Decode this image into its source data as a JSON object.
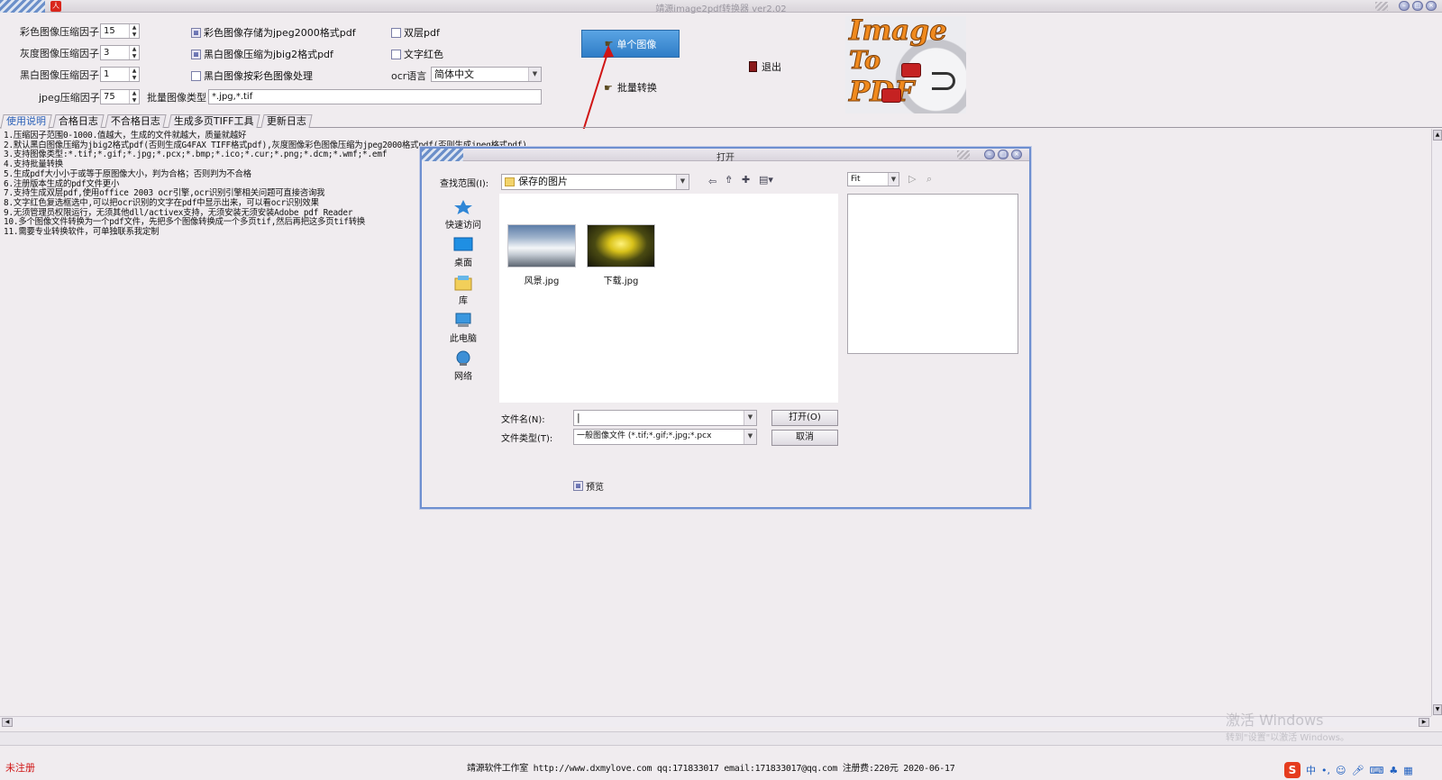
{
  "window": {
    "title": "靖源image2pdf转换器 ver2.02",
    "controls": [
      "minimize",
      "maximize",
      "close"
    ]
  },
  "settings": {
    "color_factor_label": "彩色图像压缩因子",
    "color_factor_value": "15",
    "gray_factor_label": "灰度图像压缩因子",
    "gray_factor_value": "3",
    "bw_factor_label": "黑白图像压缩因子",
    "bw_factor_value": "1",
    "jpeg_factor_label": "jpeg压缩因子",
    "jpeg_factor_value": "75",
    "opt_jpeg2000": "彩色图像存储为jpeg2000格式pdf",
    "opt_jbig2": "黑白图像压缩为jbig2格式pdf",
    "opt_bw_as_color": "黑白图像按彩色图像处理",
    "opt_dual_layer": "双层pdf",
    "opt_red_text": "文字红色",
    "ocr_label": "ocr语言",
    "ocr_value": "简体中文",
    "batch_type_label": "批量图像类型",
    "batch_type_value": "*.jpg,*.tif"
  },
  "actions": {
    "single": "单个图像",
    "batch": "批量转换",
    "exit": "退出"
  },
  "logo": {
    "line1": "Image",
    "line2": "To",
    "line3": "PDF"
  },
  "tabs": [
    "使用说明",
    "合格日志",
    "不合格日志",
    "生成多页TIFF工具",
    "更新日志"
  ],
  "instructions": [
    "1.压缩因子范围0-1000.值越大，生成的文件就越大，质量就越好",
    "2.默认黑白图像压缩为jbig2格式pdf(否则生成G4FAX TIFF格式pdf),灰度图像彩色图像压缩为jpeg2000格式pdf(否则生成jpeg格式pdf)",
    "3.支持图像类型:*.tif;*.gif;*.jpg;*.pcx;*.bmp;*.ico;*.cur;*.png;*.dcm;*.wmf;*.emf",
    "4.支持批量转换",
    "5.生成pdf大小小于或等于原图像大小，判为合格；否则判为不合格",
    "6.注册版本生成的pdf文件更小",
    "7.支持生成双层pdf,使用office 2003 ocr引擎,ocr识别引擎相关问题可直接咨询我",
    "8.文字红色复选框选中,可以把ocr识别的文字在pdf中显示出来，可以看ocr识别效果",
    "9.无须管理员权限运行，无须其他dll/activex支持，无须安装无须安装Adobe pdf Reader",
    "10.多个图像文件转换为一个pdf文件，先把多个图像转换成一个多页tif,然后再把这多页tif转换",
    "11.需要专业转换软件，可单独联系我定制"
  ],
  "dialog": {
    "title": "打开",
    "look_in_label": "查找范围(I):",
    "look_in_value": "保存的图片",
    "zoom_value": "Fit",
    "places": [
      "快速访问",
      "桌面",
      "库",
      "此电脑",
      "网络"
    ],
    "files": [
      "风景.jpg",
      "下载.jpg"
    ],
    "filename_label": "文件名(N):",
    "filename_value": "|",
    "filetype_label": "文件类型(T):",
    "filetype_value": "一般图像文件 (*.tif;*.gif;*.jpg;*.pcx",
    "open_button": "打开(O)",
    "cancel_button": "取消",
    "preview_label": "预览"
  },
  "status": {
    "unregistered": "未注册",
    "footer": "靖源软件工作室 http://www.dxmylove.com qq:171833017 email:171833017@qq.com 注册费:220元 2020-06-17"
  },
  "overlay": {
    "activate_line1": "激活 Windows",
    "activate_line2": "转到\"设置\"以激活 Windows。"
  },
  "tray": {
    "ime": "中"
  },
  "colors": {
    "accent_button": "#3b8ad6",
    "annotation_arrow": "#d01414",
    "dialog_border": "#6e8fd0",
    "unregistered_text": "#d01414"
  },
  "icons": [
    "search-range-folder-icon",
    "back-icon",
    "up-folder-icon",
    "new-folder-icon",
    "view-menu-icon",
    "quick-access-icon",
    "desktop-icon",
    "library-icon",
    "this-pc-icon",
    "network-icon"
  ]
}
